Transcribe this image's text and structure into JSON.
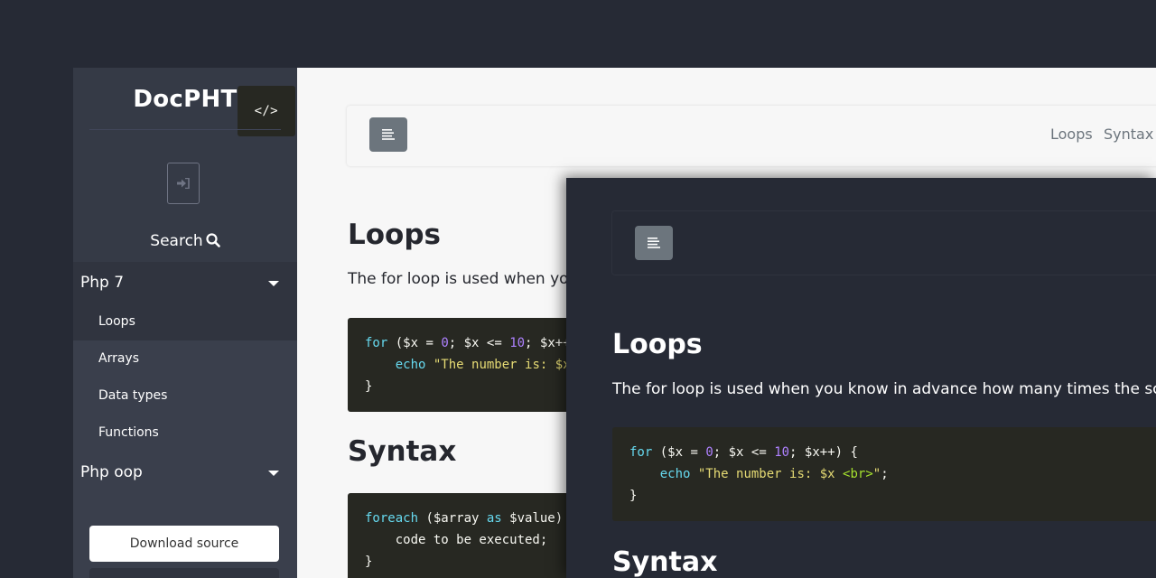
{
  "sidebar": {
    "logo": "DocPHT",
    "logo_code": "</>",
    "search_label": "Search",
    "groups": [
      {
        "label": "Php 7",
        "items": [
          "Loops",
          "Arrays",
          "Data types",
          "Functions"
        ]
      },
      {
        "label": "Php oop"
      }
    ],
    "download_label": "Download source"
  },
  "topbar": {
    "links": [
      "Loops",
      "Syntax"
    ]
  },
  "content": {
    "heading_loops": "Loops",
    "paragraph_light": "The for loop is used when you",
    "paragraph_dark": "The for loop is used when you know in advance how many times the script sh",
    "heading_syntax": "Syntax"
  },
  "code": {
    "loops_light": {
      "l1_kw": "for",
      "l1_a": " ($x = ",
      "l1_num1": "0",
      "l1_b": "; $x <= ",
      "l1_num2": "10",
      "l1_c": "; $x++)",
      "l2_indent": "    ",
      "l2_kw": "echo",
      "l2_sp": " ",
      "l2_str": "\"The number is: $x <",
      "l3": "}"
    },
    "loops_dark": {
      "l1_kw": "for",
      "l1_a": " ($x = ",
      "l1_num1": "0",
      "l1_b": "; $x <= ",
      "l1_num2": "10",
      "l1_c": "; $x++) {",
      "l2_indent": "    ",
      "l2_kw": "echo",
      "l2_sp": " ",
      "l2_str1": "\"The number is: $x ",
      "l2_tag": "<br>",
      "l2_str2": "\"",
      "l2_end": ";",
      "l3": "}"
    },
    "syntax": {
      "l1_kw": "foreach",
      "l1_a": " ($array ",
      "l1_as": "as",
      "l1_b": " $value) {",
      "l2": "    code to be executed;",
      "l3": "}"
    }
  },
  "icons": {
    "login": "sign-in-icon",
    "search": "search-icon",
    "menu": "align-left-icon",
    "caret": "caret-down-icon"
  },
  "colors": {
    "background": "#262a35",
    "sidebar": "#3a3f4c",
    "button": "#6c757d",
    "code_bg": "#272822"
  }
}
